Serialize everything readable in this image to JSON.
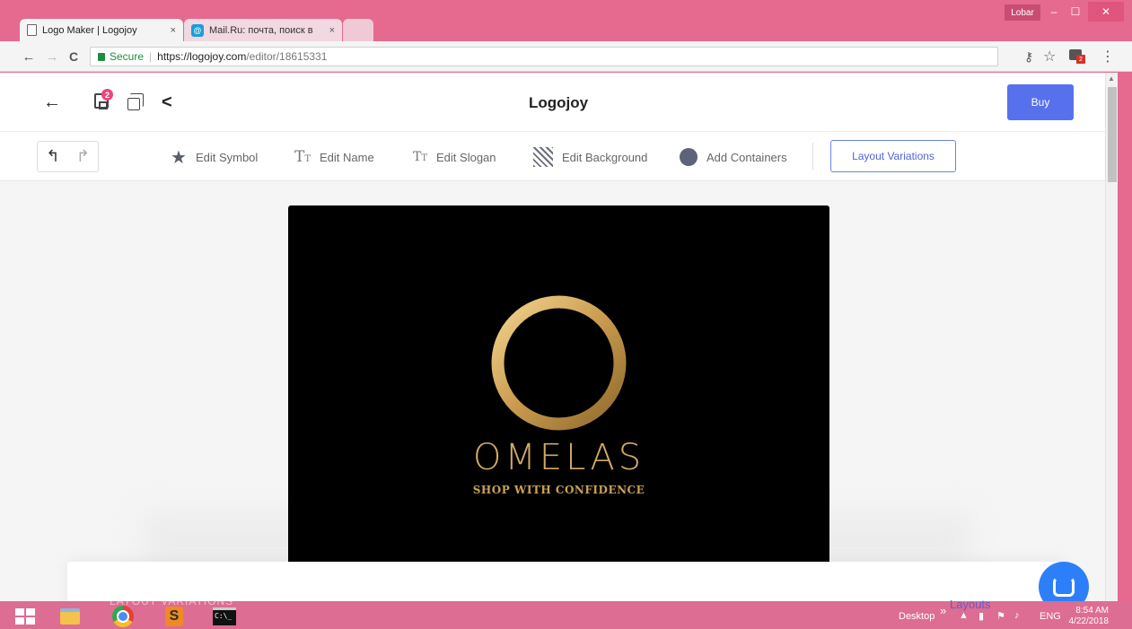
{
  "browser": {
    "tabs": [
      {
        "title": "Logo Maker | Logojoy",
        "close": "×"
      },
      {
        "title": "Mail.Ru: почта, поиск в",
        "close": "×",
        "favicon_letter": "@"
      }
    ],
    "user_name": "Lobar",
    "window_controls": {
      "minimize": "–",
      "maximize": "☐",
      "close": "✕"
    },
    "nav": {
      "back": "←",
      "forward": "→",
      "reload": "C"
    },
    "address": {
      "secure_label": "Secure",
      "separator": "|",
      "host": "https://logojoy.com",
      "path": "/editor/18615331"
    },
    "toolbar_icons": {
      "key": "⚷",
      "star": "☆",
      "menu": "⋮",
      "extension_badge": "2"
    }
  },
  "app": {
    "title": "Logojoy",
    "header_icons": {
      "back": "←",
      "share": "<",
      "save_badge": "2"
    },
    "buy_label": "Buy",
    "undo": "↰",
    "redo": "↱",
    "tools": [
      {
        "label": "Edit Symbol",
        "icon": "star-icon"
      },
      {
        "label": "Edit Name",
        "icon": "text-size-icon"
      },
      {
        "label": "Edit Slogan",
        "icon": "text-size-icon"
      },
      {
        "label": "Edit Background",
        "icon": "hatch-pattern-icon"
      },
      {
        "label": "Add Containers",
        "icon": "circle-icon"
      }
    ],
    "tool_glyphs": {
      "star": "★",
      "text_big": "T",
      "text_small": "T"
    },
    "layout_variations_label": "Layout Variations",
    "logo": {
      "name": "OMELAS",
      "slogan": "SHOP WITH CONFIDENCE",
      "background": "#000000",
      "accent": "#d1aa63"
    },
    "panel_overlay_labels": {
      "left": "LAYOUT VARIATIONS",
      "right": "Layouts"
    },
    "scroll_arrow": "▲"
  },
  "taskbar": {
    "desktop_label": "Desktop",
    "chevron": "»",
    "tray": {
      "caret": "▲",
      "language": "ENG"
    },
    "clock_time": "8:54 AM",
    "clock_date": "4/22/2018",
    "cmd_text": "C:\\_"
  },
  "colors": {
    "primary": "#5771ec",
    "titlebar": "#e6698f",
    "chat": "#2d7ff9"
  }
}
